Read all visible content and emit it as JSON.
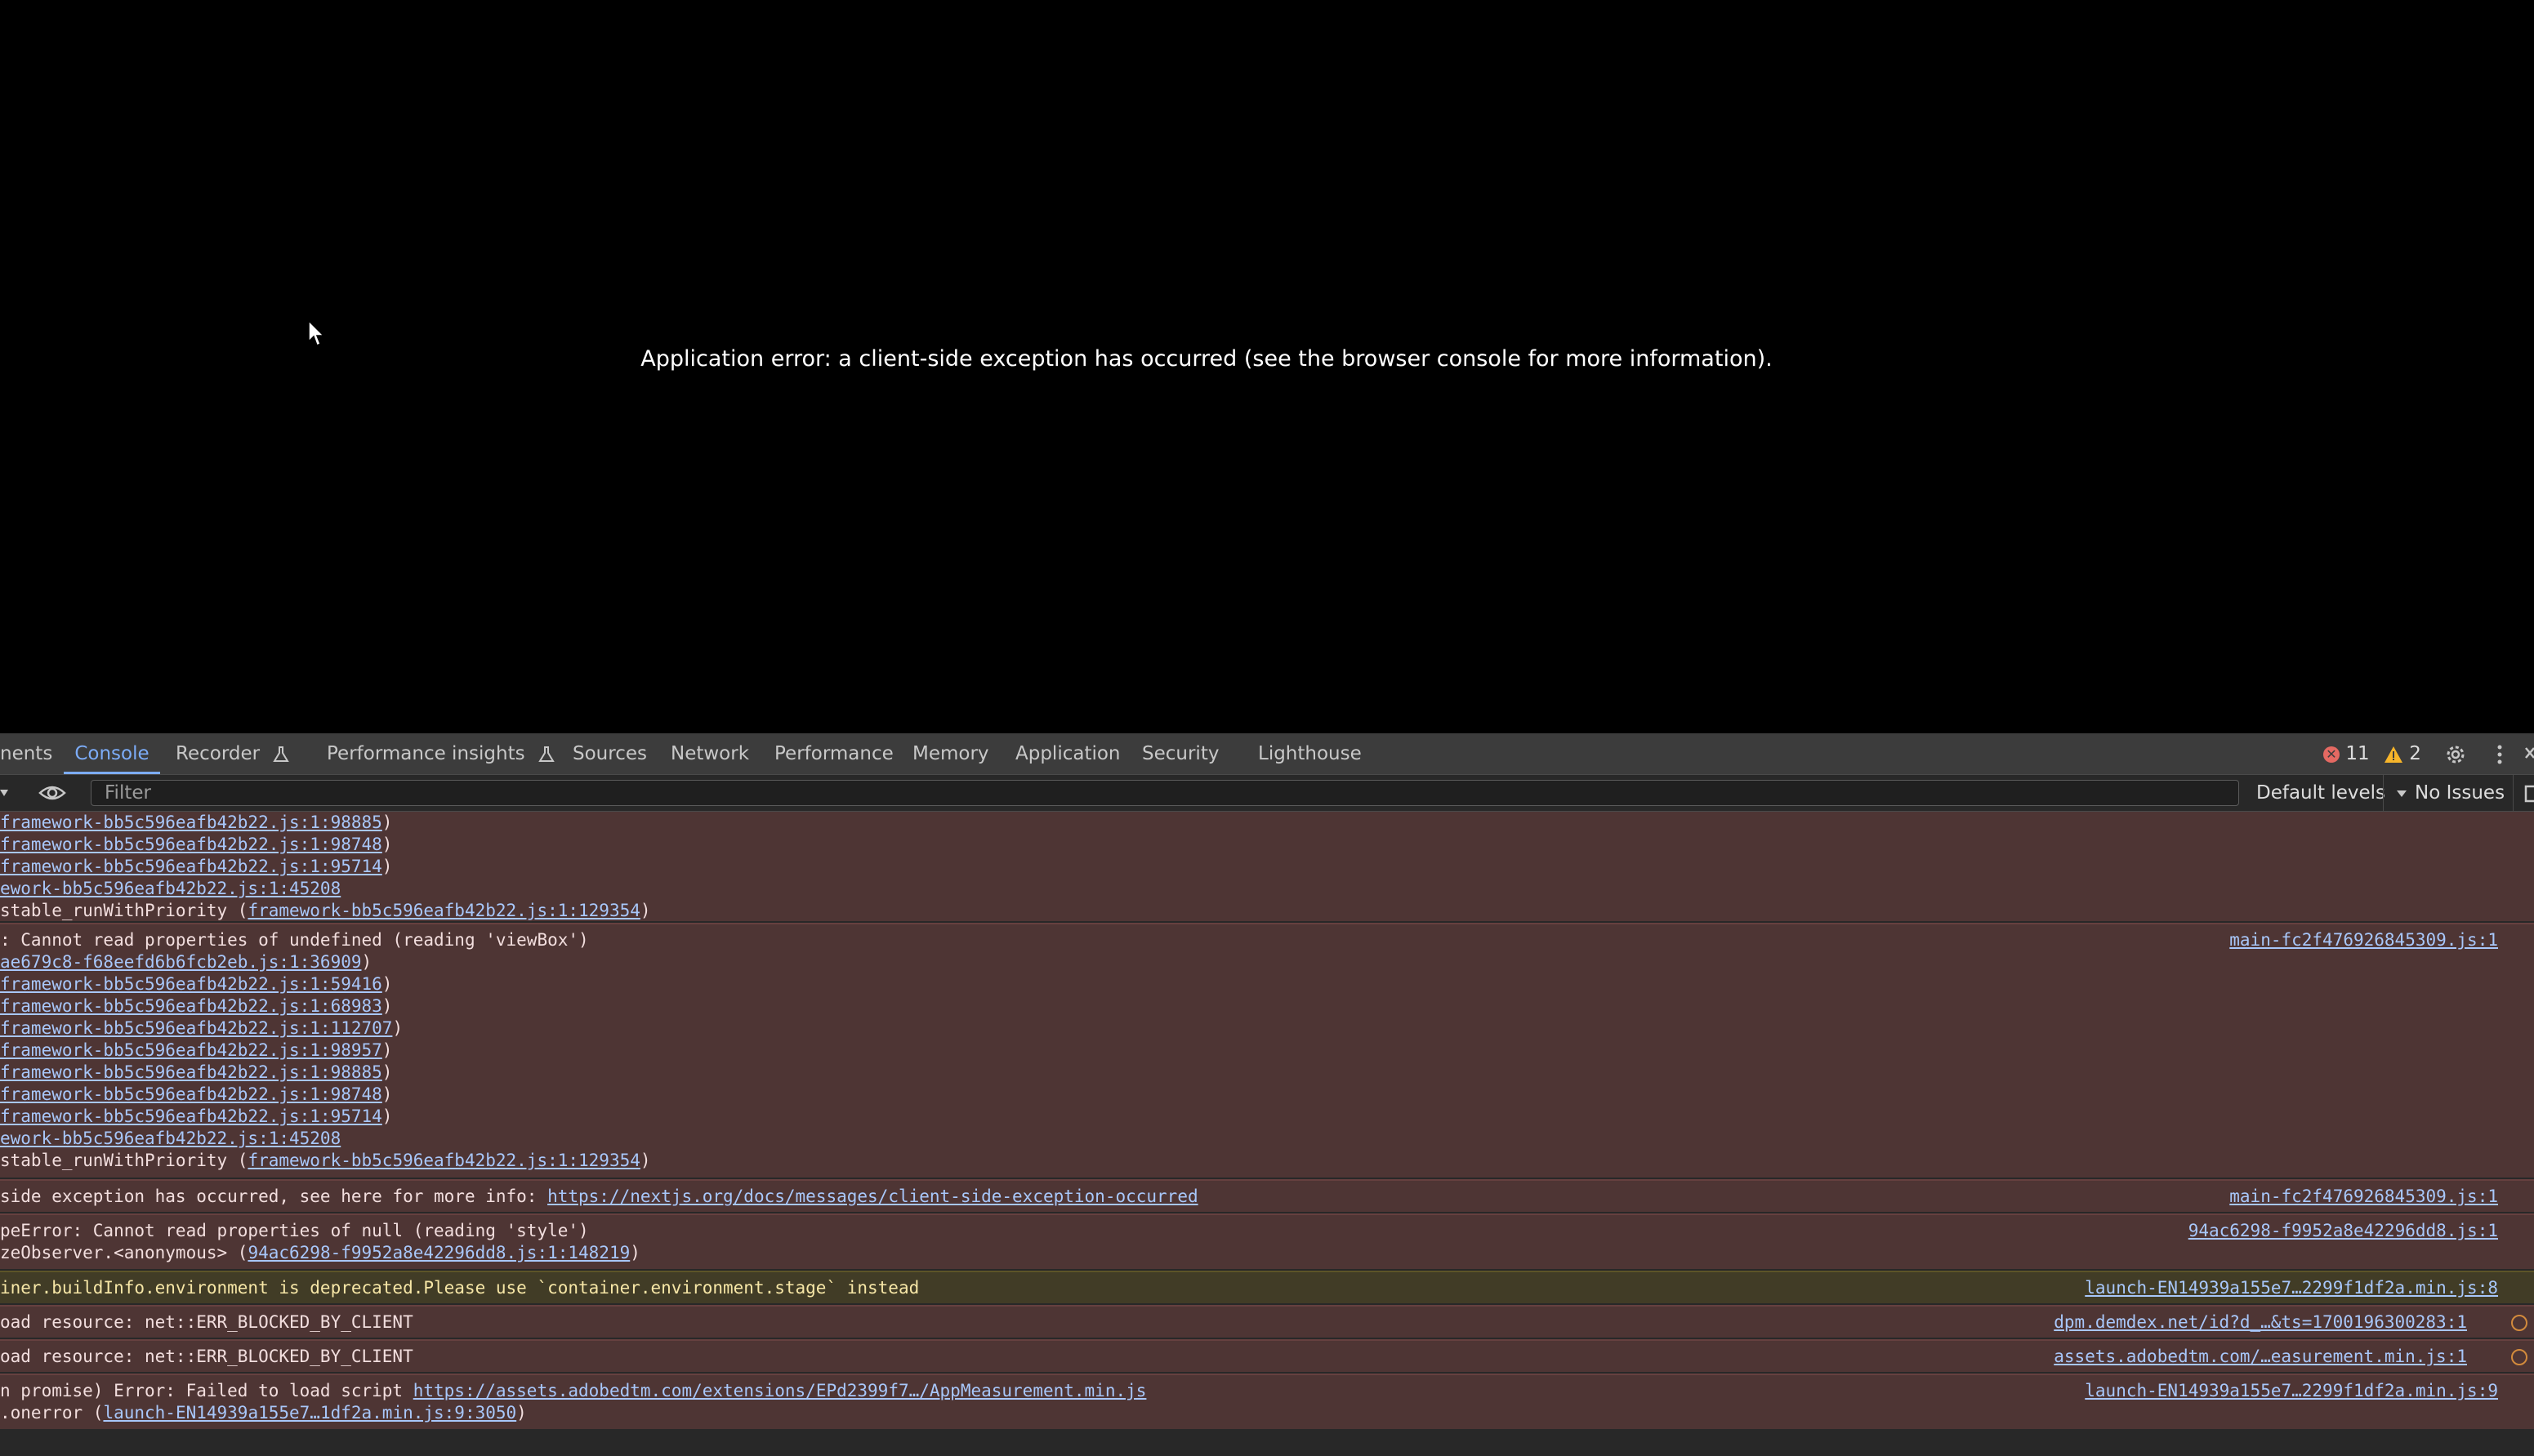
{
  "page": {
    "error_message": "Application error: a client-side exception has occurred (see the browser console for more information)."
  },
  "devtools": {
    "tabs": {
      "elements": "nents",
      "console": "Console",
      "recorder": "Recorder",
      "performance_insights": "Performance insights",
      "sources": "Sources",
      "network": "Network",
      "performance": "Performance",
      "memory": "Memory",
      "application": "Application",
      "security": "Security",
      "lighthouse": "Lighthouse"
    },
    "error_count": "11",
    "warning_count": "2",
    "filter_placeholder": "Filter",
    "levels_label": "Default levels",
    "issues_label": "No Issues",
    "colors": {
      "accent": "#7cacf8",
      "error_bg": "#4e3534",
      "warning_bg": "#413c26",
      "link": "#a8c7fa"
    }
  },
  "console": {
    "b1": {
      "l1": "framework-bb5c596eafb42b22.js:1:98885",
      "l2": "framework-bb5c596eafb42b22.js:1:98748",
      "l3": "framework-bb5c596eafb42b22.js:1:95714",
      "l4": "ework-bb5c596eafb42b22.js:1:45208",
      "l5_text": "stable_runWithPriority (",
      "l5_link": "framework-bb5c596eafb42b22.js:1:129354"
    },
    "b2": {
      "l1_text": ": Cannot read properties of undefined (reading 'viewBox')",
      "source": "main-fc2f476926845309.js:1",
      "l2": "ae679c8-f68eefd6b6fcb2eb.js:1:36909",
      "l3": "framework-bb5c596eafb42b22.js:1:59416",
      "l4": "framework-bb5c596eafb42b22.js:1:68983",
      "l5": "framework-bb5c596eafb42b22.js:1:112707",
      "l6": "framework-bb5c596eafb42b22.js:1:98957",
      "l7": "framework-bb5c596eafb42b22.js:1:98885",
      "l8": "framework-bb5c596eafb42b22.js:1:98748",
      "l9": "framework-bb5c596eafb42b22.js:1:95714",
      "l10": "ework-bb5c596eafb42b22.js:1:45208",
      "l11_text": "stable_runWithPriority (",
      "l11_link": "framework-bb5c596eafb42b22.js:1:129354"
    },
    "b3": {
      "text": "side exception has occurred, see here for more info: ",
      "link": "https://nextjs.org/docs/messages/client-side-exception-occurred",
      "source": "main-fc2f476926845309.js:1"
    },
    "b4": {
      "l1_text": "peError: Cannot read properties of null (reading 'style')",
      "source": "94ac6298-f9952a8e42296dd8.js:1",
      "l2_text": "zeObserver.<anonymous> (",
      "l2_link": "94ac6298-f9952a8e42296dd8.js:1:148219"
    },
    "b5": {
      "text": "iner.buildInfo.environment is deprecated.Please use `container.environment.stage` instead",
      "source": "launch-EN14939a155e7…2299f1df2a.min.js:8"
    },
    "b6": {
      "text": "oad resource: net::ERR_BLOCKED_BY_CLIENT",
      "source": "dpm.demdex.net/id?d_…&ts=1700196300283:1"
    },
    "b7": {
      "text": "oad resource: net::ERR_BLOCKED_BY_CLIENT",
      "source": "assets.adobedtm.com/…easurement.min.js:1"
    },
    "b8": {
      "l1_text": "n promise) Error: Failed to load script ",
      "l1_link": "https://assets.adobedtm.com/extensions/EPd2399f7…/AppMeasurement.min.js",
      "source": "launch-EN14939a155e7…2299f1df2a.min.js:9",
      "l2_text": ".onerror (",
      "l2_link": "launch-EN14939a155e7…1df2a.min.js:9:3050"
    }
  }
}
